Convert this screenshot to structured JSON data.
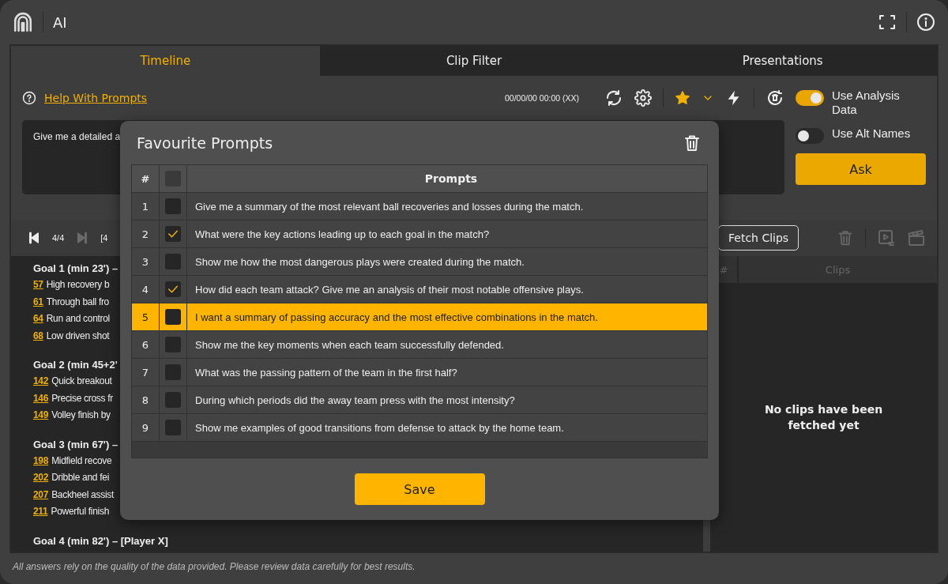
{
  "app": {
    "title": "AI"
  },
  "tabs": [
    {
      "label": "Timeline",
      "selected": true
    },
    {
      "label": "Clip Filter",
      "selected": false
    },
    {
      "label": "Presentations",
      "selected": false
    }
  ],
  "toolbar": {
    "help_link": "Help With Prompts",
    "timestamp": "00/00/00 00:00  (XX)"
  },
  "prompt_field": {
    "value": "Give me a detailed a"
  },
  "toggles": [
    {
      "label": "Use Analysis Data",
      "on": true
    },
    {
      "label": "Use Alt Names",
      "on": false
    }
  ],
  "ask_button": "Ask",
  "navigator": {
    "counter": "4/4",
    "range": "[4"
  },
  "timeline": [
    {
      "heading": "Goal 1 (min 23') –",
      "events": [
        {
          "frame": "57",
          "text": "High recovery b"
        },
        {
          "frame": "61",
          "text": "Through ball fro"
        },
        {
          "frame": "64",
          "text": "Run and control"
        },
        {
          "frame": "68",
          "text": "Low driven shot"
        }
      ]
    },
    {
      "heading": "Goal 2 (min 45+2'",
      "events": [
        {
          "frame": "142",
          "text": "Quick breakout"
        },
        {
          "frame": "146",
          "text": "Precise cross fr"
        },
        {
          "frame": "149",
          "text": "Volley finish by"
        }
      ]
    },
    {
      "heading": "Goal 3 (min 67') –",
      "events": [
        {
          "frame": "198",
          "text": "Midfield recove"
        },
        {
          "frame": "202",
          "text": "Dribble and fei"
        },
        {
          "frame": "207",
          "text": "Backheel assist"
        },
        {
          "frame": "211",
          "text": "Powerful finish"
        }
      ]
    },
    {
      "heading": "Goal 4 (min 82') – [Player X]"
    }
  ],
  "clips": {
    "fetch_button": "Fetch Clips",
    "columns": [
      "#",
      "Clips"
    ],
    "empty_message": "No clips have been fetched yet"
  },
  "footer": "All answers rely on the quality of the data provided. Please review data carefully for best results.",
  "modal": {
    "title": "Favourite Prompts",
    "columns": [
      "#",
      "Prompts"
    ],
    "header_checked": false,
    "rows": [
      {
        "number": "1",
        "checked": false,
        "selected": false,
        "prompt": "Give me a summary of the most relevant ball recoveries and losses during the match."
      },
      {
        "number": "2",
        "checked": true,
        "selected": false,
        "prompt": "What were the key actions leading up to each goal in the match?"
      },
      {
        "number": "3",
        "checked": false,
        "selected": false,
        "prompt": "Show me how the most dangerous plays were created during the match."
      },
      {
        "number": "4",
        "checked": true,
        "selected": false,
        "prompt": "How did each team attack? Give me an analysis of their most notable offensive plays."
      },
      {
        "number": "5",
        "checked": false,
        "selected": true,
        "prompt": "I want a summary of passing accuracy and the most effective combinations in the match."
      },
      {
        "number": "6",
        "checked": false,
        "selected": false,
        "prompt": "Show me the key moments when each team successfully defended."
      },
      {
        "number": "7",
        "checked": false,
        "selected": false,
        "prompt": "What was the passing pattern of the team in the first half?"
      },
      {
        "number": "8",
        "checked": false,
        "selected": false,
        "prompt": "During which periods did the away team press with the most intensity?"
      },
      {
        "number": "9",
        "checked": false,
        "selected": false,
        "prompt": "Show me examples of good transitions from defense to attack by the home team."
      }
    ],
    "save_button": "Save"
  }
}
